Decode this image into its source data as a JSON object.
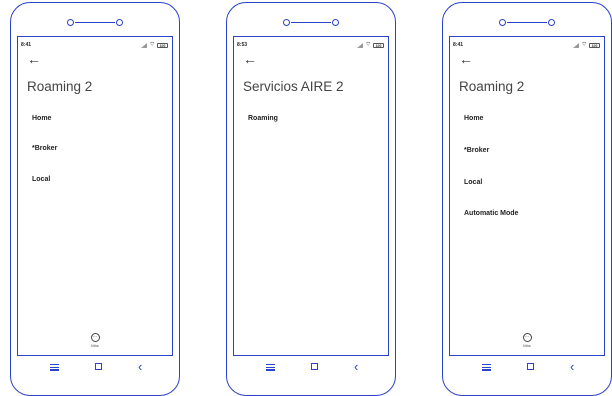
{
  "phones": [
    {
      "time": "8:41",
      "battery": "100",
      "title": "Roaming 2",
      "items": [
        "Home",
        "*Broker",
        "Local"
      ],
      "more": "Más"
    },
    {
      "time": "8:53",
      "battery": "100",
      "title": "Servicios AIRE 2",
      "items": [
        "Roaming"
      ]
    },
    {
      "time": "8:41",
      "battery": "100",
      "title": "Roaming 2",
      "items": [
        "Home",
        "*Broker",
        "Local",
        "Automatic Mode"
      ],
      "more": "Más"
    }
  ],
  "icons": {
    "back": "back-arrow-icon",
    "more": "more-icon",
    "nav_menu": "menu-icon",
    "nav_home": "square-home-icon",
    "nav_back": "chevron-left-icon",
    "signal": "signal-icon",
    "wifi": "wifi-icon",
    "battery": "battery-icon"
  },
  "colors": {
    "frame": "#2b43c8",
    "text": "#222222",
    "title": "#444444"
  }
}
